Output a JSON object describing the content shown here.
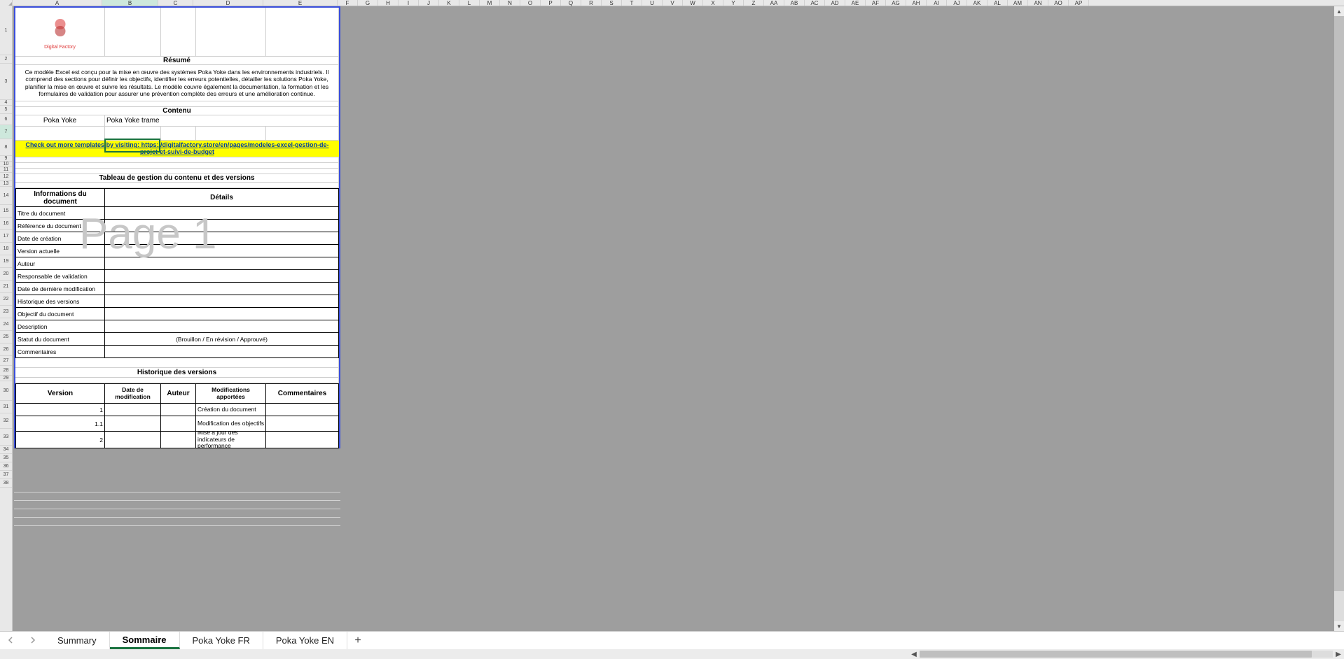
{
  "columns": [
    "A",
    "B",
    "C",
    "D",
    "E",
    "F",
    "G",
    "H",
    "I",
    "J",
    "K",
    "L",
    "M",
    "N",
    "O",
    "P",
    "Q",
    "R",
    "S",
    "T",
    "U",
    "V",
    "W",
    "X",
    "Y",
    "Z",
    "AA",
    "AB",
    "AC",
    "AD",
    "AE",
    "AF",
    "AG",
    "AH",
    "AI",
    "AJ",
    "AK",
    "AL",
    "AM",
    "AN",
    "AO",
    "AP"
  ],
  "rowCount": 38,
  "logo": {
    "brand": "Digital Factory"
  },
  "sections": {
    "resume_title": "Résumé",
    "resume_body": "Ce modèle Excel est conçu pour la mise en œuvre des systèmes Poka Yoke dans les environnements industriels. Il comprend des sections pour définir les objectifs, identifier les erreurs potentielles, détailler les solutions Poka Yoke, planifier la mise en œuvre et suivre les résultats. Le modèle couvre également la documentation, la formation et les formulaires de validation pour assurer une prévention complète des erreurs et une amélioration continue.",
    "contenu_title": "Contenu",
    "contenu_items": [
      "Poka Yoke",
      "Poka Yoke trame"
    ],
    "promo_link": "Check out more templates by visiting: https://digitalfactory.store/en/pages/modeles-excel-gestion-de-projet-et-suivi-de-budget",
    "table_mgmt_title": "Tableau de gestion du contenu et des versions",
    "doc_info_hdr": [
      "Informations du document",
      "Détails"
    ],
    "doc_info_rows": [
      {
        "label": "Titre du document",
        "value": ""
      },
      {
        "label": "Référence du document",
        "value": ""
      },
      {
        "label": "Date de création",
        "value": ""
      },
      {
        "label": "Version actuelle",
        "value": ""
      },
      {
        "label": "Auteur",
        "value": ""
      },
      {
        "label": "Responsable de validation",
        "value": ""
      },
      {
        "label": "Date de dernière modification",
        "value": ""
      },
      {
        "label": "Historique des versions",
        "value": ""
      },
      {
        "label": "Objectif du document",
        "value": ""
      },
      {
        "label": "Description",
        "value": ""
      },
      {
        "label": "Statut du document",
        "value": "(Brouillon / En révision / Approuvé)"
      },
      {
        "label": "Commentaires",
        "value": ""
      }
    ],
    "history_title": "Historique des versions",
    "history_hdr": [
      "Version",
      "Date de modification",
      "Auteur",
      "Modifications apportées",
      "Commentaires"
    ],
    "history_rows": [
      {
        "v": "1",
        "d": "",
        "a": "",
        "m": "Création du document",
        "c": ""
      },
      {
        "v": "1.1",
        "d": "",
        "a": "",
        "m": "Modification des objectifs",
        "c": ""
      },
      {
        "v": "2",
        "d": "",
        "a": "",
        "m": "Mise à jour des indicateurs de performance",
        "c": ""
      }
    ]
  },
  "watermark": "Page 1",
  "tabs": [
    "Summary",
    "Sommaire",
    "Poka Yoke FR",
    "Poka Yoke EN"
  ],
  "activeTab": 1
}
